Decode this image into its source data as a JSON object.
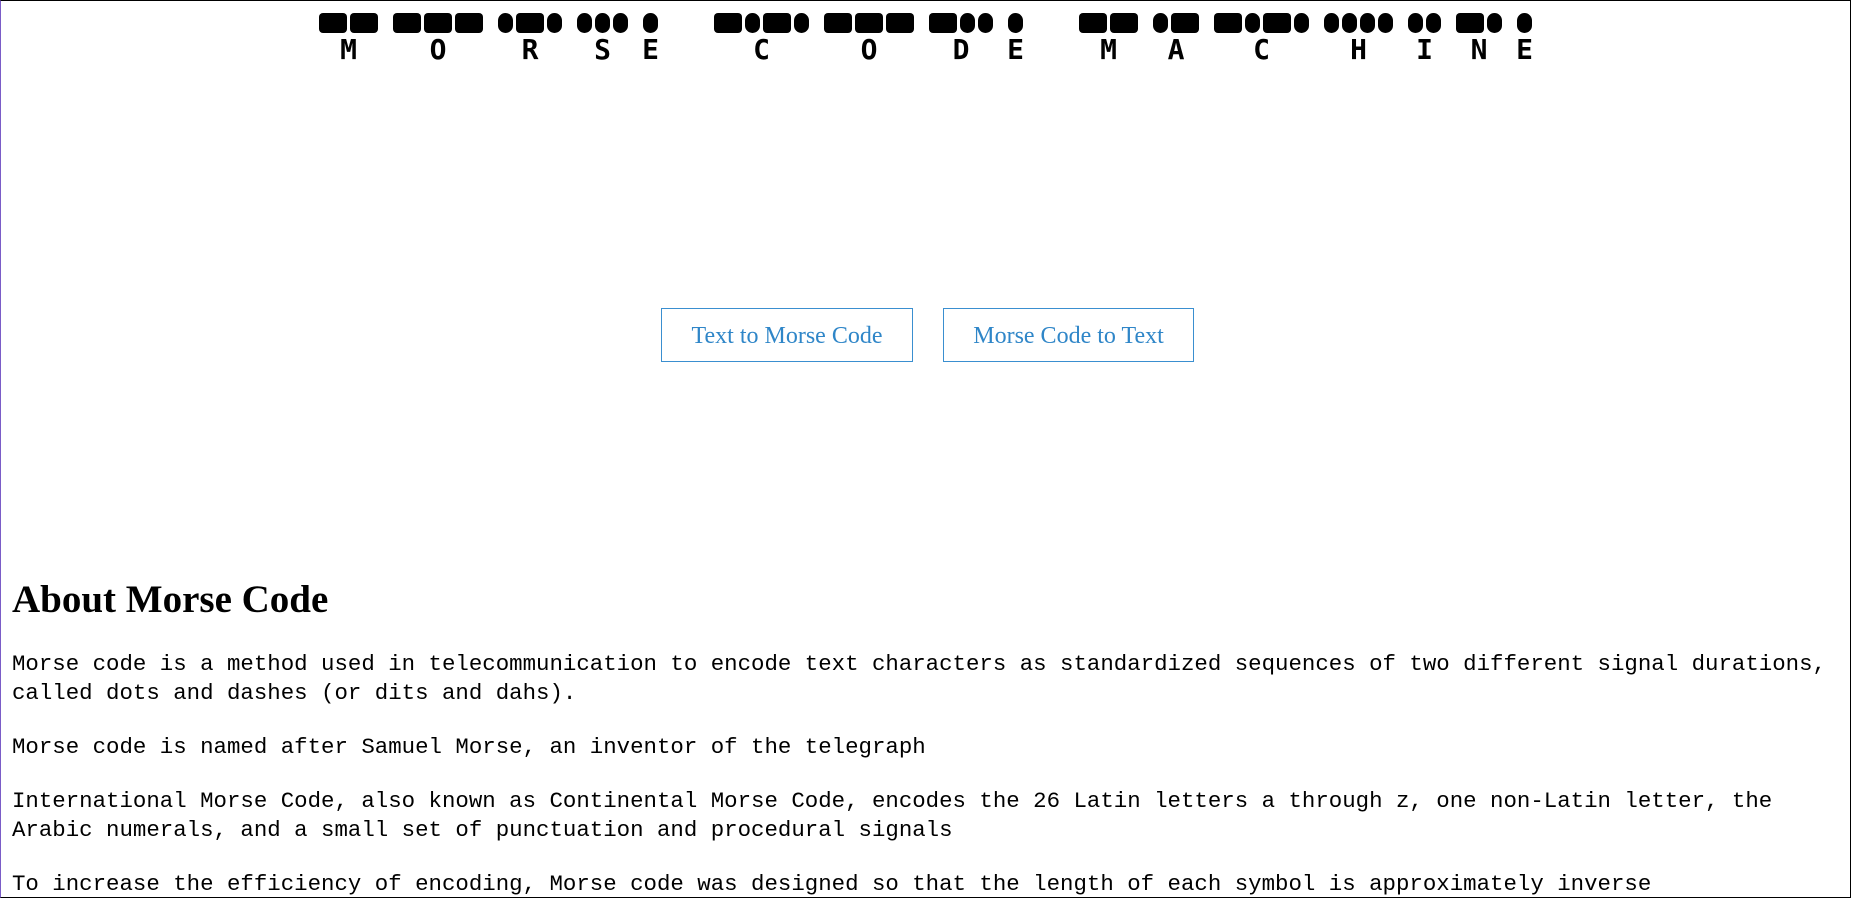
{
  "header": {
    "title_words": [
      {
        "letters": [
          "M",
          "O",
          "R",
          "S",
          "E"
        ]
      },
      {
        "letters": [
          "C",
          "O",
          "D",
          "E"
        ]
      },
      {
        "letters": [
          "M",
          "A",
          "C",
          "H",
          "I",
          "N",
          "E"
        ]
      }
    ],
    "morse": {
      "M": "--",
      "O": "---",
      "R": ".-.",
      "S": "...",
      "E": ".",
      "C": "-.-.",
      "D": "-..",
      "A": ".-",
      "H": "....",
      "I": "..",
      "N": "-."
    }
  },
  "buttons": {
    "text_to_morse": "Text to Morse Code",
    "morse_to_text": "Morse Code to Text"
  },
  "about": {
    "heading": "About Morse Code",
    "paragraphs": [
      "Morse code is a method used in telecommunication to encode text characters as standardized sequences of two different signal durations, called dots and dashes (or dits and dahs).",
      "Morse code is named after Samuel Morse, an inventor of the telegraph",
      "International Morse Code, also known as Continental Morse Code, encodes the 26 Latin letters a through z, one non-Latin letter, the Arabic numerals, and a small set of punctuation and procedural signals",
      "To increase the efficiency of encoding, Morse code was designed so that the length of each symbol is approximately inverse"
    ]
  },
  "colors": {
    "button_border": "#3a8fd0",
    "button_text": "#2f86c8"
  }
}
